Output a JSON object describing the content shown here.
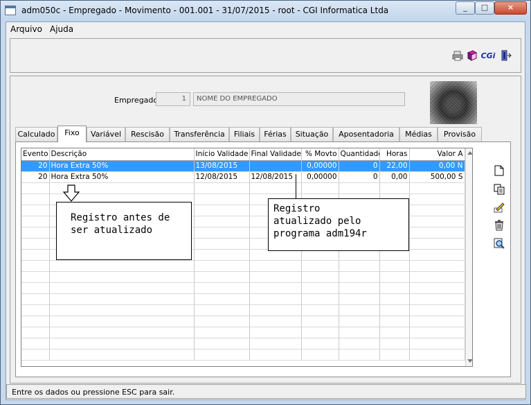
{
  "window": {
    "title": "adm050c - Empregado - Movimento - 001.001 - 31/07/2015 - root - CGI Informatica Ltda"
  },
  "menu": [
    {
      "label": "Arquivo"
    },
    {
      "label": "Ajuda"
    }
  ],
  "toolbar": {
    "icons": [
      "printer-icon",
      "book-icon",
      "cgi-logo-icon",
      "exit-icon"
    ],
    "cgi_label": "CGi"
  },
  "employee": {
    "label": "Empregado:",
    "code": "1",
    "name": "NOME DO EMPREGADO"
  },
  "tabs": [
    {
      "label": "Calculado"
    },
    {
      "label": "Fixo"
    },
    {
      "label": "Variável"
    },
    {
      "label": "Rescisão"
    },
    {
      "label": "Transferência"
    },
    {
      "label": "Filiais"
    },
    {
      "label": "Férias"
    },
    {
      "label": "Situação"
    },
    {
      "label": "Aposentadoria"
    },
    {
      "label": "Médias"
    },
    {
      "label": "Provisão"
    }
  ],
  "active_tab": "Fixo",
  "grid": {
    "columns": [
      "Evento",
      "Descrição",
      "Início Validade",
      "Final Validade",
      "% Movto",
      "Quantidade",
      "Horas",
      "Valor A"
    ],
    "rows": [
      {
        "evento": "20",
        "descricao": "Hora Extra 50%",
        "inicio": "13/08/2015",
        "final": "",
        "movto": "0,00000",
        "quantidade": "0",
        "horas": "22,00",
        "valor": "0,00",
        "flag": "N"
      },
      {
        "evento": "20",
        "descricao": "Hora Extra 50%",
        "inicio": "12/08/2015",
        "final": "12/08/2015",
        "movto": "0,00000",
        "quantidade": "0",
        "horas": "0,00",
        "valor": "500,00",
        "flag": "S"
      }
    ]
  },
  "annotations": {
    "before": "Registro antes de\nser atualizado",
    "after": "Registro\natualizado pelo\nprograma adm194r"
  },
  "side_buttons": [
    "new-document-icon",
    "copy-icon",
    "edit-icon",
    "delete-icon",
    "search-icon"
  ],
  "status": "Entre os dados ou pressione ESC para sair."
}
